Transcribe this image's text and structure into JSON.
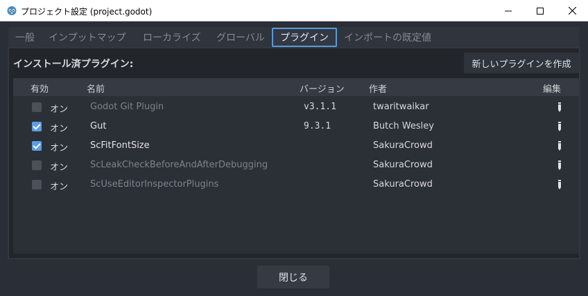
{
  "window": {
    "title": "プロジェクト設定 (project.godot)",
    "icon": "godot-icon"
  },
  "tabs": [
    {
      "label": "一般",
      "active": false
    },
    {
      "label": "インプットマップ",
      "active": false
    },
    {
      "label": "ローカライズ",
      "active": false
    },
    {
      "label": "グローバル",
      "active": false
    },
    {
      "label": "プラグイン",
      "active": true
    },
    {
      "label": "インポートの既定値",
      "active": false
    }
  ],
  "plugins_panel": {
    "label": "インストール済プラグイン:",
    "create_button": "新しいプラグインを作成"
  },
  "table": {
    "headers": {
      "enabled": "有効",
      "name": "名前",
      "version": "バージョン",
      "author": "作者",
      "edit": "編集"
    },
    "rows": [
      {
        "checked": false,
        "toggle": "オン",
        "name": "Godot Git Plugin",
        "version": "v3.1.1",
        "author": "twaritwaikar"
      },
      {
        "checked": true,
        "toggle": "オン",
        "name": "Gut",
        "version": "9.3.1",
        "author": "Butch Wesley"
      },
      {
        "checked": true,
        "toggle": "オン",
        "name": "ScFitFontSize",
        "version": "",
        "author": "SakuraCrowd"
      },
      {
        "checked": false,
        "toggle": "オン",
        "name": "ScLeakCheckBeforeAndAfterDebugging",
        "version": "",
        "author": "SakuraCrowd"
      },
      {
        "checked": false,
        "toggle": "オン",
        "name": "ScUseEditorInspectorPlugins",
        "version": "",
        "author": "SakuraCrowd"
      }
    ]
  },
  "footer": {
    "close_button": "閉じる"
  },
  "colors": {
    "accent": "#5a9ad9",
    "checkbox_checked": "#5b9ee6",
    "background": "#2a2e36"
  }
}
